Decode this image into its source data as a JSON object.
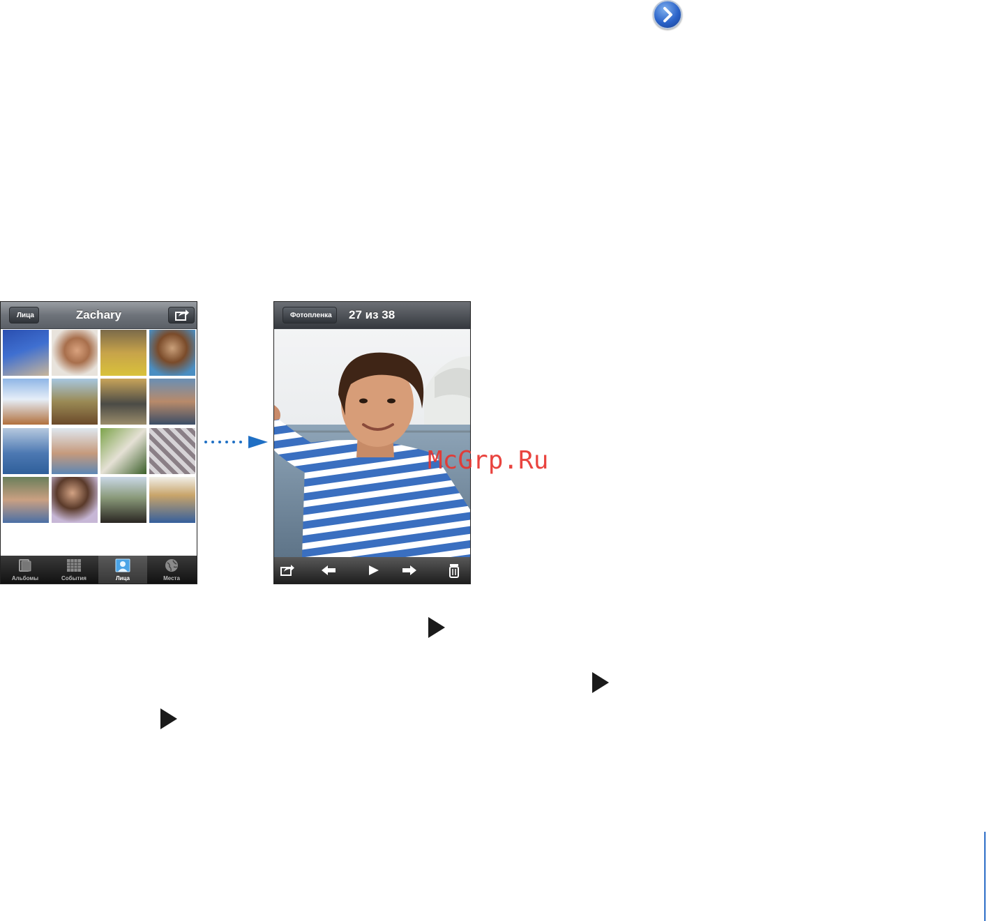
{
  "left_phone": {
    "back_label": "Лица",
    "title": "Zachary",
    "tabs": [
      {
        "label": "Альбомы",
        "icon": "albums-icon"
      },
      {
        "label": "События",
        "icon": "events-icon"
      },
      {
        "label": "Лица",
        "icon": "faces-icon",
        "selected": true
      },
      {
        "label": "Места",
        "icon": "places-icon"
      }
    ]
  },
  "right_phone": {
    "back_label": "Фотопленка",
    "title": "27 из 38",
    "toolbar": [
      "share-icon",
      "previous-arrow-icon",
      "play-icon",
      "next-arrow-icon",
      "trash-icon"
    ]
  },
  "watermark": "McGrp.Ru",
  "colors": {
    "accent": "#1f6fc4",
    "watermark": "#e8352f",
    "nav_gray": "#6e737a"
  }
}
